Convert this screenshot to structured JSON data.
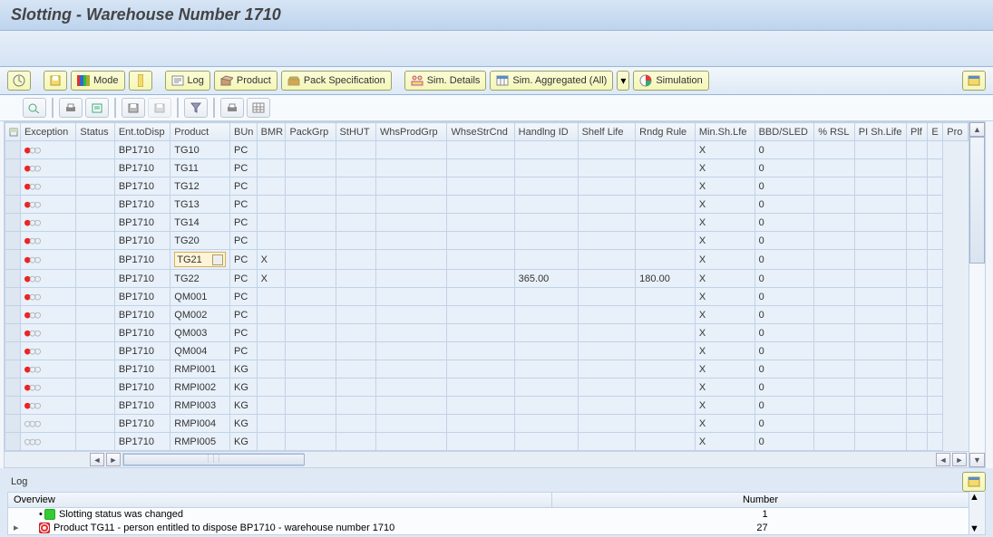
{
  "title": "Slotting - Warehouse Number 1710",
  "toolbar": {
    "mode_label": "Mode",
    "log_label": "Log",
    "product_label": "Product",
    "pack_spec_label": "Pack Specification",
    "sim_details_label": "Sim. Details",
    "sim_agg_label": "Sim. Aggregated (All)",
    "simulation_label": "Simulation"
  },
  "columns": [
    "Exception",
    "Status",
    "Ent.toDisp",
    "Product",
    "BUn",
    "BMR",
    "PackGrp",
    "StHUT",
    "WhsProdGrp",
    "WhseStrCnd",
    "Handlng ID",
    "Shelf Life",
    "Rndg Rule",
    "Min.Sh.Lfe",
    "BBD/SLED",
    "% RSL",
    "PI Sh.Life",
    "Plf",
    "E",
    "Pro"
  ],
  "rows": [
    {
      "exc": "red",
      "ent": "BP1710",
      "prod": "TG10",
      "bun": "PC",
      "bmr": "",
      "shelf": "",
      "minsh": "",
      "bbd": "X",
      "rsl": "0"
    },
    {
      "exc": "red",
      "ent": "BP1710",
      "prod": "TG11",
      "bun": "PC",
      "bmr": "",
      "shelf": "",
      "minsh": "",
      "bbd": "X",
      "rsl": "0"
    },
    {
      "exc": "red",
      "ent": "BP1710",
      "prod": "TG12",
      "bun": "PC",
      "bmr": "",
      "shelf": "",
      "minsh": "",
      "bbd": "X",
      "rsl": "0"
    },
    {
      "exc": "red",
      "ent": "BP1710",
      "prod": "TG13",
      "bun": "PC",
      "bmr": "",
      "shelf": "",
      "minsh": "",
      "bbd": "X",
      "rsl": "0"
    },
    {
      "exc": "red",
      "ent": "BP1710",
      "prod": "TG14",
      "bun": "PC",
      "bmr": "",
      "shelf": "",
      "minsh": "",
      "bbd": "X",
      "rsl": "0"
    },
    {
      "exc": "red",
      "ent": "BP1710",
      "prod": "TG20",
      "bun": "PC",
      "bmr": "",
      "shelf": "",
      "minsh": "",
      "bbd": "X",
      "rsl": "0"
    },
    {
      "exc": "red",
      "ent": "BP1710",
      "prod": "TG21",
      "bun": "PC",
      "bmr": "X",
      "shelf": "",
      "minsh": "",
      "bbd": "X",
      "rsl": "0",
      "editing": true
    },
    {
      "exc": "red",
      "ent": "BP1710",
      "prod": "TG22",
      "bun": "PC",
      "bmr": "X",
      "shelf": "365.00",
      "minsh": "180.00",
      "bbd": "X",
      "rsl": "0"
    },
    {
      "exc": "red",
      "ent": "BP1710",
      "prod": "QM001",
      "bun": "PC",
      "bmr": "",
      "shelf": "",
      "minsh": "",
      "bbd": "X",
      "rsl": "0"
    },
    {
      "exc": "red",
      "ent": "BP1710",
      "prod": "QM002",
      "bun": "PC",
      "bmr": "",
      "shelf": "",
      "minsh": "",
      "bbd": "X",
      "rsl": "0"
    },
    {
      "exc": "red",
      "ent": "BP1710",
      "prod": "QM003",
      "bun": "PC",
      "bmr": "",
      "shelf": "",
      "minsh": "",
      "bbd": "X",
      "rsl": "0"
    },
    {
      "exc": "red",
      "ent": "BP1710",
      "prod": "QM004",
      "bun": "PC",
      "bmr": "",
      "shelf": "",
      "minsh": "",
      "bbd": "X",
      "rsl": "0"
    },
    {
      "exc": "red",
      "ent": "BP1710",
      "prod": "RMPI001",
      "bun": "KG",
      "bmr": "",
      "shelf": "",
      "minsh": "",
      "bbd": "X",
      "rsl": "0"
    },
    {
      "exc": "red",
      "ent": "BP1710",
      "prod": "RMPI002",
      "bun": "KG",
      "bmr": "",
      "shelf": "",
      "minsh": "",
      "bbd": "X",
      "rsl": "0"
    },
    {
      "exc": "red",
      "ent": "BP1710",
      "prod": "RMPI003",
      "bun": "KG",
      "bmr": "",
      "shelf": "",
      "minsh": "",
      "bbd": "X",
      "rsl": "0"
    },
    {
      "exc": "none",
      "ent": "BP1710",
      "prod": "RMPI004",
      "bun": "KG",
      "bmr": "",
      "shelf": "",
      "minsh": "",
      "bbd": "X",
      "rsl": "0"
    },
    {
      "exc": "none",
      "ent": "BP1710",
      "prod": "RMPI005",
      "bun": "KG",
      "bmr": "",
      "shelf": "",
      "minsh": "",
      "bbd": "X",
      "rsl": "0"
    }
  ],
  "log": {
    "label": "Log",
    "overview_title": "Overview",
    "number_title": "Number",
    "items": [
      {
        "icon": "green",
        "text": "Slotting status was changed",
        "num": "1",
        "expandable": false
      },
      {
        "icon": "red",
        "text": "Product TG11 - person entitled to dispose BP1710 - warehouse number 1710",
        "num": "27",
        "expandable": true
      }
    ]
  }
}
